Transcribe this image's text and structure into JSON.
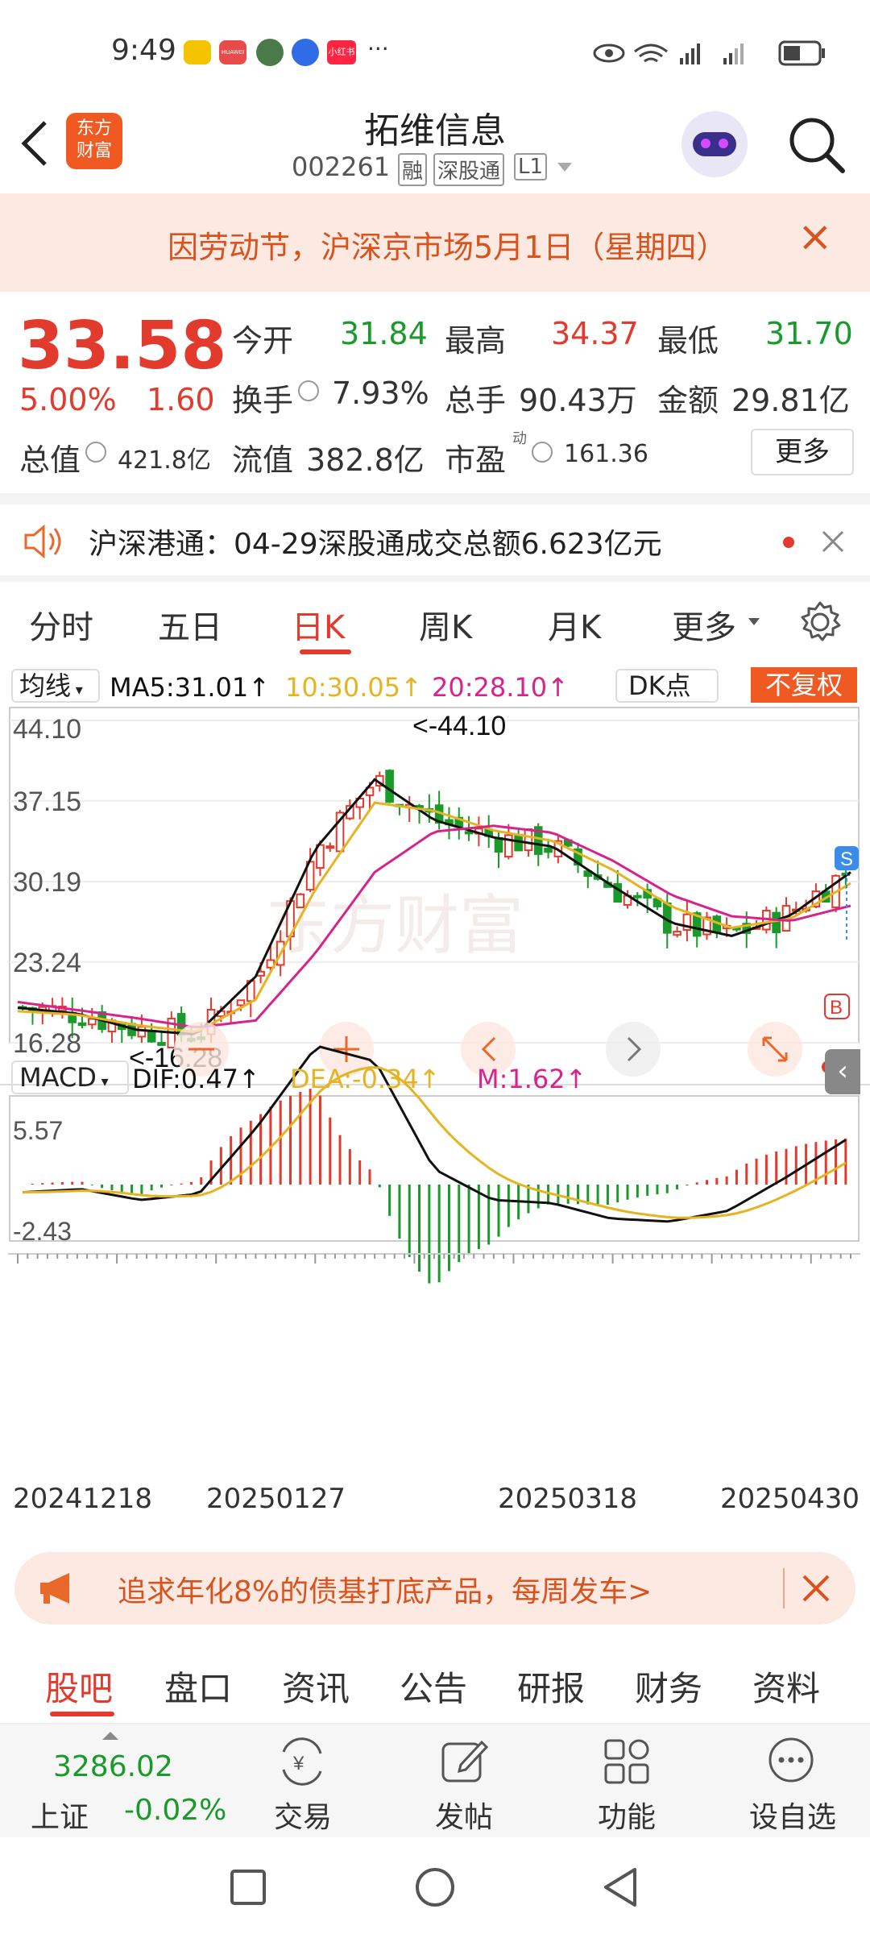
{
  "status": {
    "time": "9:49",
    "icons": [
      "weibo-icon",
      "huawei-icon",
      "avatar-icon",
      "baidu-icon",
      "xiaohongshu-icon"
    ],
    "more": "···",
    "huawei_label": "HUAWEI",
    "xhs_label": "小红书"
  },
  "header": {
    "title": "拓维信息",
    "code": "002261",
    "tags": [
      "融",
      "深股通",
      "L1"
    ],
    "logo": "东方\n财富"
  },
  "notice": {
    "text": "因劳动节，沪深京市场5月1日（星期四）",
    "close": "×"
  },
  "quote": {
    "price": "33.58",
    "change_pct": "5.00%",
    "change": "1.60",
    "open_label": "今开",
    "open": "31.84",
    "high_label": "最高",
    "high": "34.37",
    "low_label": "最低",
    "low": "31.70",
    "turnover_label": "换手",
    "turnover": "7.93%",
    "volume_label": "总手",
    "volume": "90.43万",
    "amount_label": "金额",
    "amount": "29.81亿",
    "mktcap_label": "总值",
    "mktcap": "421.8亿",
    "float_label": "流值",
    "float": "382.8亿",
    "pe_label": "市盈",
    "pe_sup": "动",
    "pe": "161.36",
    "more": "更多"
  },
  "news": {
    "text": "沪深港通：04-29深股通成交总额6.623亿元"
  },
  "tabs": [
    "分时",
    "五日",
    "日K",
    "周K",
    "月K",
    "更多"
  ],
  "chart": {
    "ma_selector": "均线",
    "ma5": "MA5:31.01↑",
    "ma10": "10:30.05↑",
    "ma20": "20:28.10↑",
    "dk": "DK点",
    "fq": "不复权",
    "y_ticks": [
      "44.10",
      "37.15",
      "30.19",
      "23.24",
      "16.28"
    ],
    "max_label": "<-44.10",
    "min_label": "<-16.28",
    "macd_selector": "MACD",
    "dif": "DIF:0.47↑",
    "dea": "DEA:-0.34↑",
    "m": "M:1.62↑",
    "macd_ticks": [
      "5.57",
      "-2.43"
    ],
    "dates": [
      "20241218",
      "20250127",
      "20250318",
      "20250430"
    ],
    "watermark": "东方财富",
    "s_mark": "S",
    "b_mark": "B"
  },
  "chart_data": {
    "type": "line",
    "title": "",
    "ylim": [
      16.28,
      44.1
    ],
    "x": [
      "20241218",
      "20250127",
      "20250318",
      "20250430"
    ],
    "series": [
      {
        "name": "MA5",
        "values": [
          19.3,
          18.8,
          17.4,
          17.0,
          22.0,
          33.0,
          39.0,
          35.5,
          34.0,
          33.2,
          29.8,
          26.6,
          25.5,
          27.3,
          31.0
        ]
      },
      {
        "name": "10",
        "values": [
          19.0,
          18.7,
          17.8,
          17.2,
          20.0,
          29.5,
          37.0,
          36.3,
          34.6,
          33.7,
          31.2,
          28.0,
          26.2,
          27.0,
          30.05
        ]
      },
      {
        "name": "20",
        "values": [
          19.8,
          19.1,
          18.4,
          17.6,
          18.2,
          24.0,
          31.0,
          34.5,
          35.0,
          34.4,
          32.0,
          29.0,
          27.2,
          26.8,
          28.1
        ]
      }
    ]
  },
  "ad": {
    "text": "追求年化8%的债基打底产品，每周发车>"
  },
  "bottom_tabs": [
    "股吧",
    "盘口",
    "资讯",
    "公告",
    "研报",
    "财务",
    "资料"
  ],
  "toolbar": {
    "index_value": "3286.02",
    "index_name": "上证",
    "index_change": "-0.02%",
    "items": [
      "交易",
      "发帖",
      "功能",
      "设自选"
    ]
  },
  "colors": {
    "accent": "#e23b2e",
    "up": "#e23b2e",
    "down": "#1a9a2a",
    "ma5": "#111111",
    "ma10": "#e6b422",
    "ma20": "#d6248c"
  }
}
